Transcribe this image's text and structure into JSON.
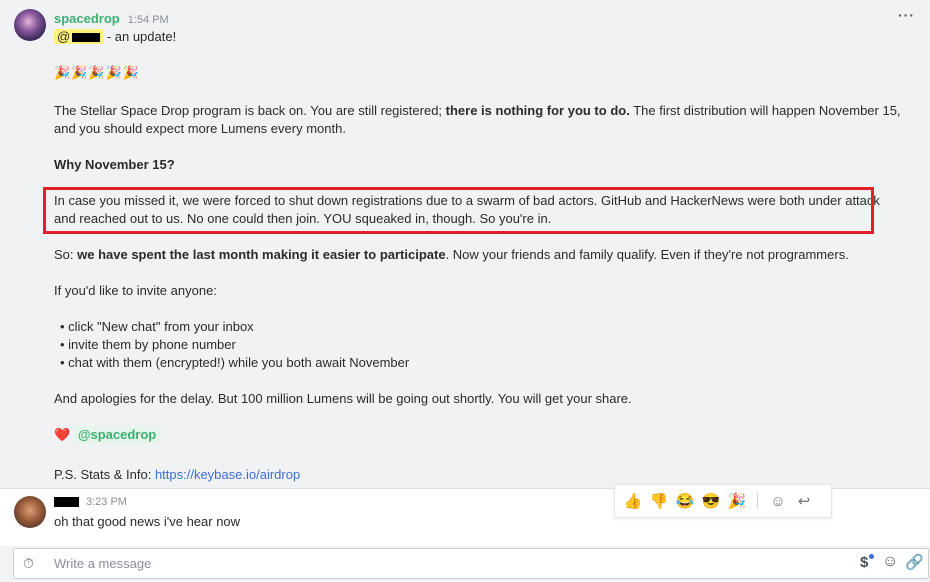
{
  "message1": {
    "username": "spacedrop",
    "time": "1:54 PM",
    "mention_prefix": "@",
    "greeting": " - an update!",
    "party": "🎉🎉🎉🎉🎉",
    "para1_a": "The Stellar Space Drop program is back on. You are still registered; ",
    "para1_b": "there is nothing for you to do.",
    "para1_c": " The first distribution will happen November 15, and you should expect more Lumens every month.",
    "why_heading": "Why November 15?",
    "para2": "In case you missed it, we were forced to shut down registrations due to a swarm of bad actors. GitHub and HackerNews were both under attack and reached out to us.  No one could then join. YOU squeaked in, though. So you're in.",
    "para3_a": "So: ",
    "para3_b": "we have spent the last month making it easier to participate",
    "para3_c": ". Now your friends and family qualify. Even if they're not programmers.",
    "para4": "If you'd like to invite anyone:",
    "bullets": [
      "• click \"New chat\" from your inbox",
      "• invite them by phone number",
      "• chat with them (encrypted!) while you both await November"
    ],
    "para5": "And apologies for the delay. But 100 million Lumens will be going out shortly. You will get your share.",
    "heart": "❤️",
    "signature": "@spacedrop",
    "ps_label": "P.S. Stats & Info: ",
    "ps_link": "https://keybase.io/airdrop",
    "more": "···"
  },
  "message2": {
    "time": "3:23 PM",
    "text": "oh that good news i've hear now"
  },
  "reactions": {
    "thumbs_up": "👍",
    "thumbs_down": "👎",
    "joy": "😂",
    "cool": "😎",
    "tada": "🎉",
    "add_reaction": "☺",
    "reply": "↩"
  },
  "composer": {
    "placeholder": "Write a message",
    "timer": "⏱",
    "dollar": "$",
    "smile": "☺",
    "clip": "🔗"
  }
}
